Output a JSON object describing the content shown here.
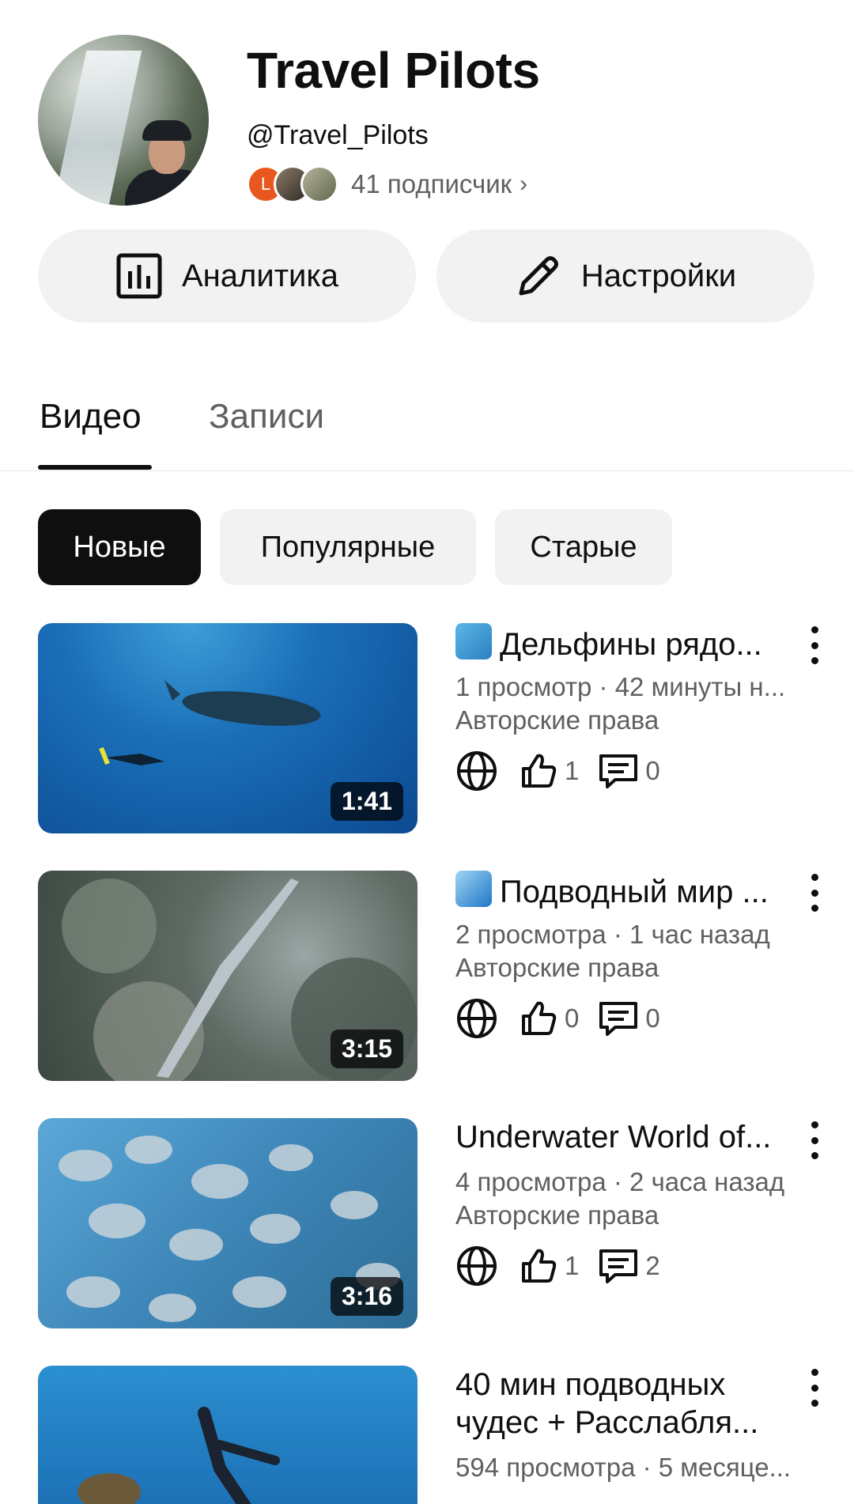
{
  "channel": {
    "name": "Travel Pilots",
    "handle": "@Travel_Pilots",
    "subscriber_initial": "L",
    "subscribers": "41 подписчик",
    "chevron": "›"
  },
  "actions": {
    "analytics_label": "Аналитика",
    "settings_label": "Настройки"
  },
  "tabs": [
    {
      "label": "Видео",
      "active": true
    },
    {
      "label": "Записи",
      "active": false
    }
  ],
  "filters": [
    {
      "label": "Новые",
      "selected": true
    },
    {
      "label": "Популярные",
      "selected": false
    },
    {
      "label": "Старые",
      "selected": false
    }
  ],
  "videos": [
    {
      "title": "Дельфины рядо...",
      "emoji_icon": "dolphin-icon",
      "meta": "1 просмотр · 42 минуты н...",
      "license": "Авторские права",
      "likes": "1",
      "comments": "0",
      "duration": "1:41"
    },
    {
      "title": "Подводный мир ...",
      "emoji_icon": "wave-icon",
      "meta": "2 просмотра · 1 час назад",
      "license": "Авторские права",
      "likes": "0",
      "comments": "0",
      "duration": "3:15"
    },
    {
      "title": "Underwater World of...",
      "meta": "4 просмотра · 2 часа назад",
      "license": "Авторские права",
      "likes": "1",
      "comments": "2",
      "duration": "3:16"
    },
    {
      "title": "40 мин подводных чудес + Расслабля...",
      "meta": "594 просмотра · 5 месяце..."
    }
  ],
  "colors": {
    "text_primary": "#0f0f0f",
    "text_secondary": "#606060",
    "chip_bg": "#f2f2f2",
    "chip_selected_bg": "#0f0f0f",
    "subscriber_avatar_l": "#e8571e"
  }
}
